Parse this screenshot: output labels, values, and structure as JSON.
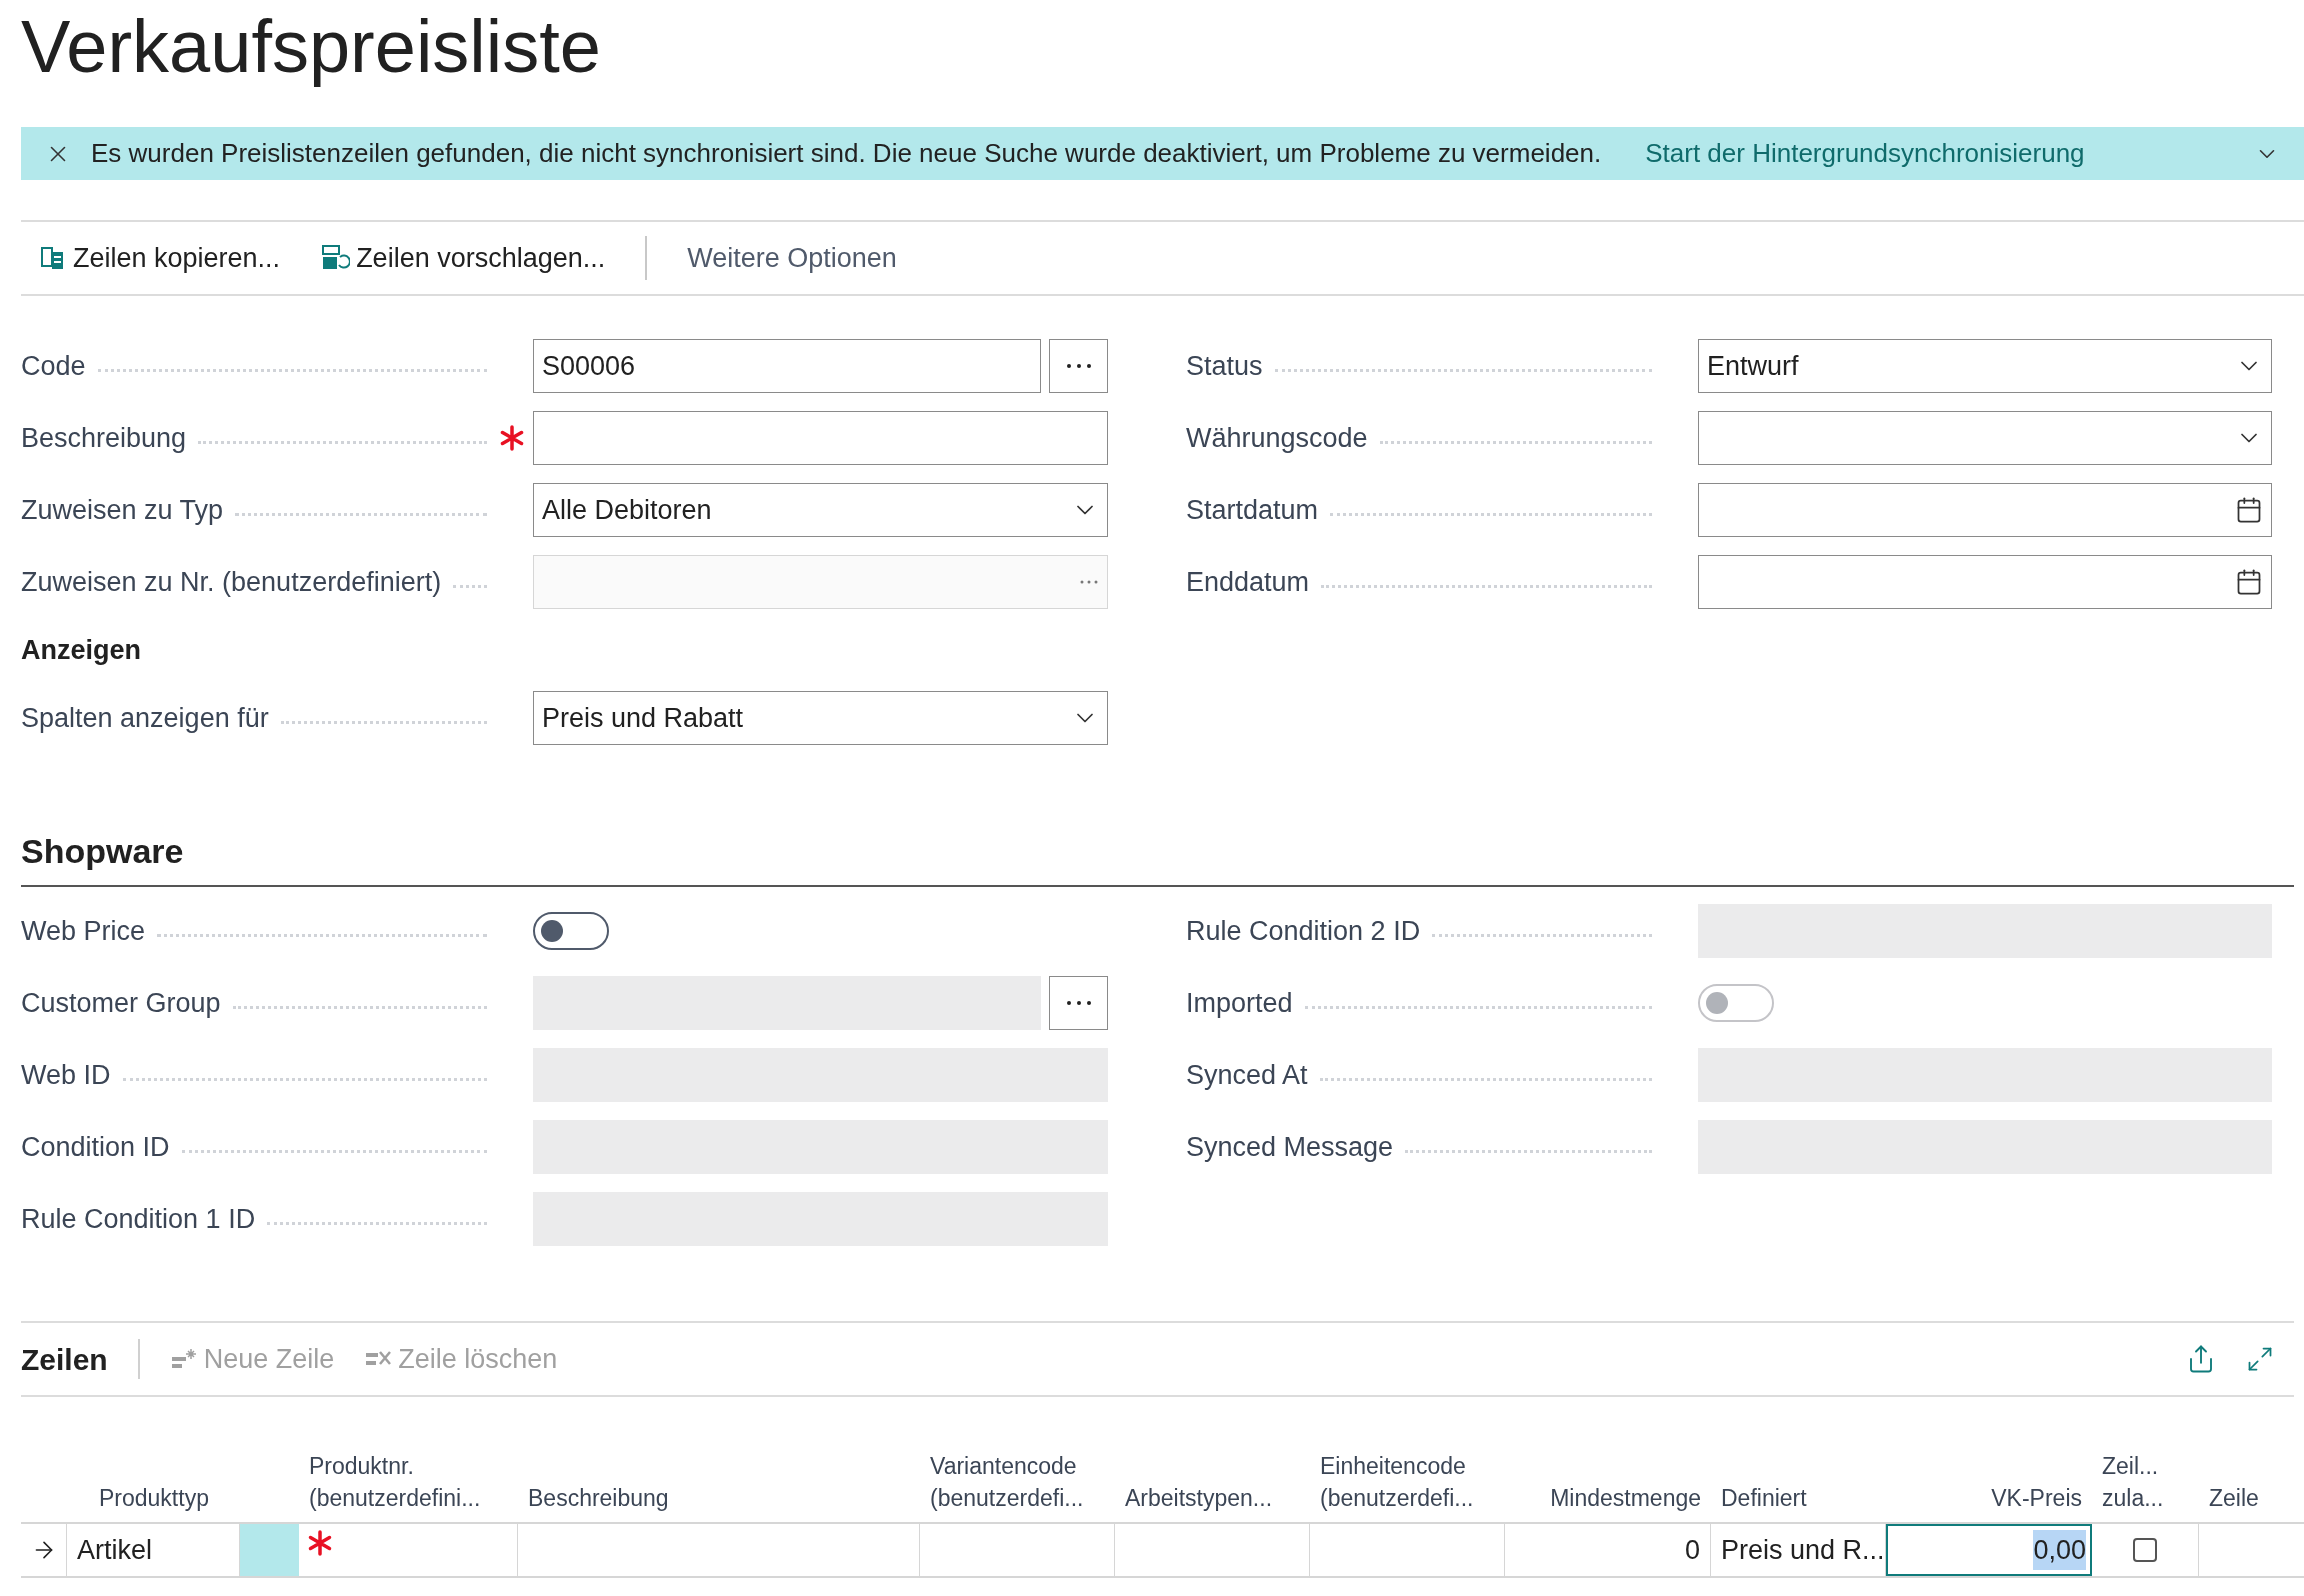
{
  "title": "Verkaufspreisliste",
  "banner": {
    "message": "Es wurden Preislistenzeilen gefunden, die nicht synchronisiert sind. Die neue Suche wurde deaktiviert, um Probleme zu vermeiden.",
    "link": "Start der Hintergrundsynchronisierung"
  },
  "actions": [
    {
      "label": "Zeilen kopieren...",
      "kind": "copy"
    },
    {
      "label": "Zeilen vorschlagen...",
      "kind": "suggest"
    },
    {
      "label": "Weitere Optionen",
      "kind": "more"
    }
  ],
  "general": {
    "left": [
      {
        "label": "Code",
        "kind": "lookup",
        "value": "S00006",
        "required": false,
        "disabled": false
      },
      {
        "label": "Beschreibung",
        "kind": "text",
        "required": true,
        "disabled": false
      },
      {
        "label": "Zuweisen zu Typ",
        "kind": "dropdown",
        "value": "Alle Debitoren",
        "required": false,
        "disabled": false
      },
      {
        "label": "Zuweisen zu Nr. (benutzerdefiniert)",
        "kind": "inline_lookup",
        "required": false,
        "disabled": true
      }
    ],
    "right": [
      {
        "label": "Status",
        "kind": "dropdown",
        "value": "Entwurf",
        "required": false,
        "disabled": false
      },
      {
        "label": "Währungscode",
        "kind": "dropdown",
        "required": false,
        "disabled": false
      },
      {
        "label": "Startdatum",
        "kind": "date",
        "required": false,
        "disabled": false
      },
      {
        "label": "Enddatum",
        "kind": "date",
        "required": false,
        "disabled": false
      }
    ]
  },
  "display": {
    "heading": "Anzeigen",
    "fields": [
      {
        "label": "Spalten anzeigen für",
        "kind": "dropdown",
        "value": "Preis und Rabatt",
        "required": false,
        "disabled": false
      }
    ]
  },
  "shopware": {
    "heading": "Shopware",
    "left": [
      {
        "label": "Web Price",
        "kind": "toggle",
        "on": false,
        "disabled": false
      },
      {
        "label": "Customer Group",
        "kind": "lookup",
        "required": false,
        "disabled": true
      },
      {
        "label": "Web ID",
        "kind": "text",
        "required": false,
        "disabled": true
      },
      {
        "label": "Condition ID",
        "kind": "text",
        "required": false,
        "disabled": true
      },
      {
        "label": "Rule Condition 1 ID",
        "kind": "text",
        "required": false,
        "disabled": true
      }
    ],
    "right": [
      {
        "label": "Rule Condition 2 ID",
        "kind": "text",
        "required": false,
        "disabled": true
      },
      {
        "label": "Imported",
        "kind": "toggle",
        "on": false,
        "disabled": true
      },
      {
        "label": "Synced At",
        "kind": "text",
        "required": false,
        "disabled": true
      },
      {
        "label": "Synced Message",
        "kind": "text",
        "required": false,
        "disabled": true
      }
    ]
  },
  "lines": {
    "heading": "Zeilen",
    "actions": [
      {
        "label": "Neue Zeile",
        "kind": "new",
        "disabled": true
      },
      {
        "label": "Zeile löschen",
        "kind": "delete",
        "disabled": true
      }
    ],
    "columns": [
      {},
      {
        "label": "Produkttyp"
      },
      {},
      {
        "label": "Produktnr. (benutzerdefini..."
      },
      {
        "label": "Beschreibung"
      },
      {
        "label": "Variantencode (benutzerdefi..."
      },
      {
        "label": "Arbeitstypen..."
      },
      {
        "label": "Einheitencode (benutzerdefi..."
      },
      {
        "label": "Mindestmenge"
      },
      {
        "label": "Definiert"
      },
      {
        "label": "VK-Preis"
      },
      {
        "label": "Zeil... zula..."
      },
      {
        "label": "Zeile"
      }
    ],
    "rows": [
      {
        "current": true,
        "product_type": "Artikel",
        "product_required": true,
        "min_qty": "0",
        "defined": "Preis und R...",
        "price": "0,00",
        "allow_line_discount": false
      }
    ]
  }
}
